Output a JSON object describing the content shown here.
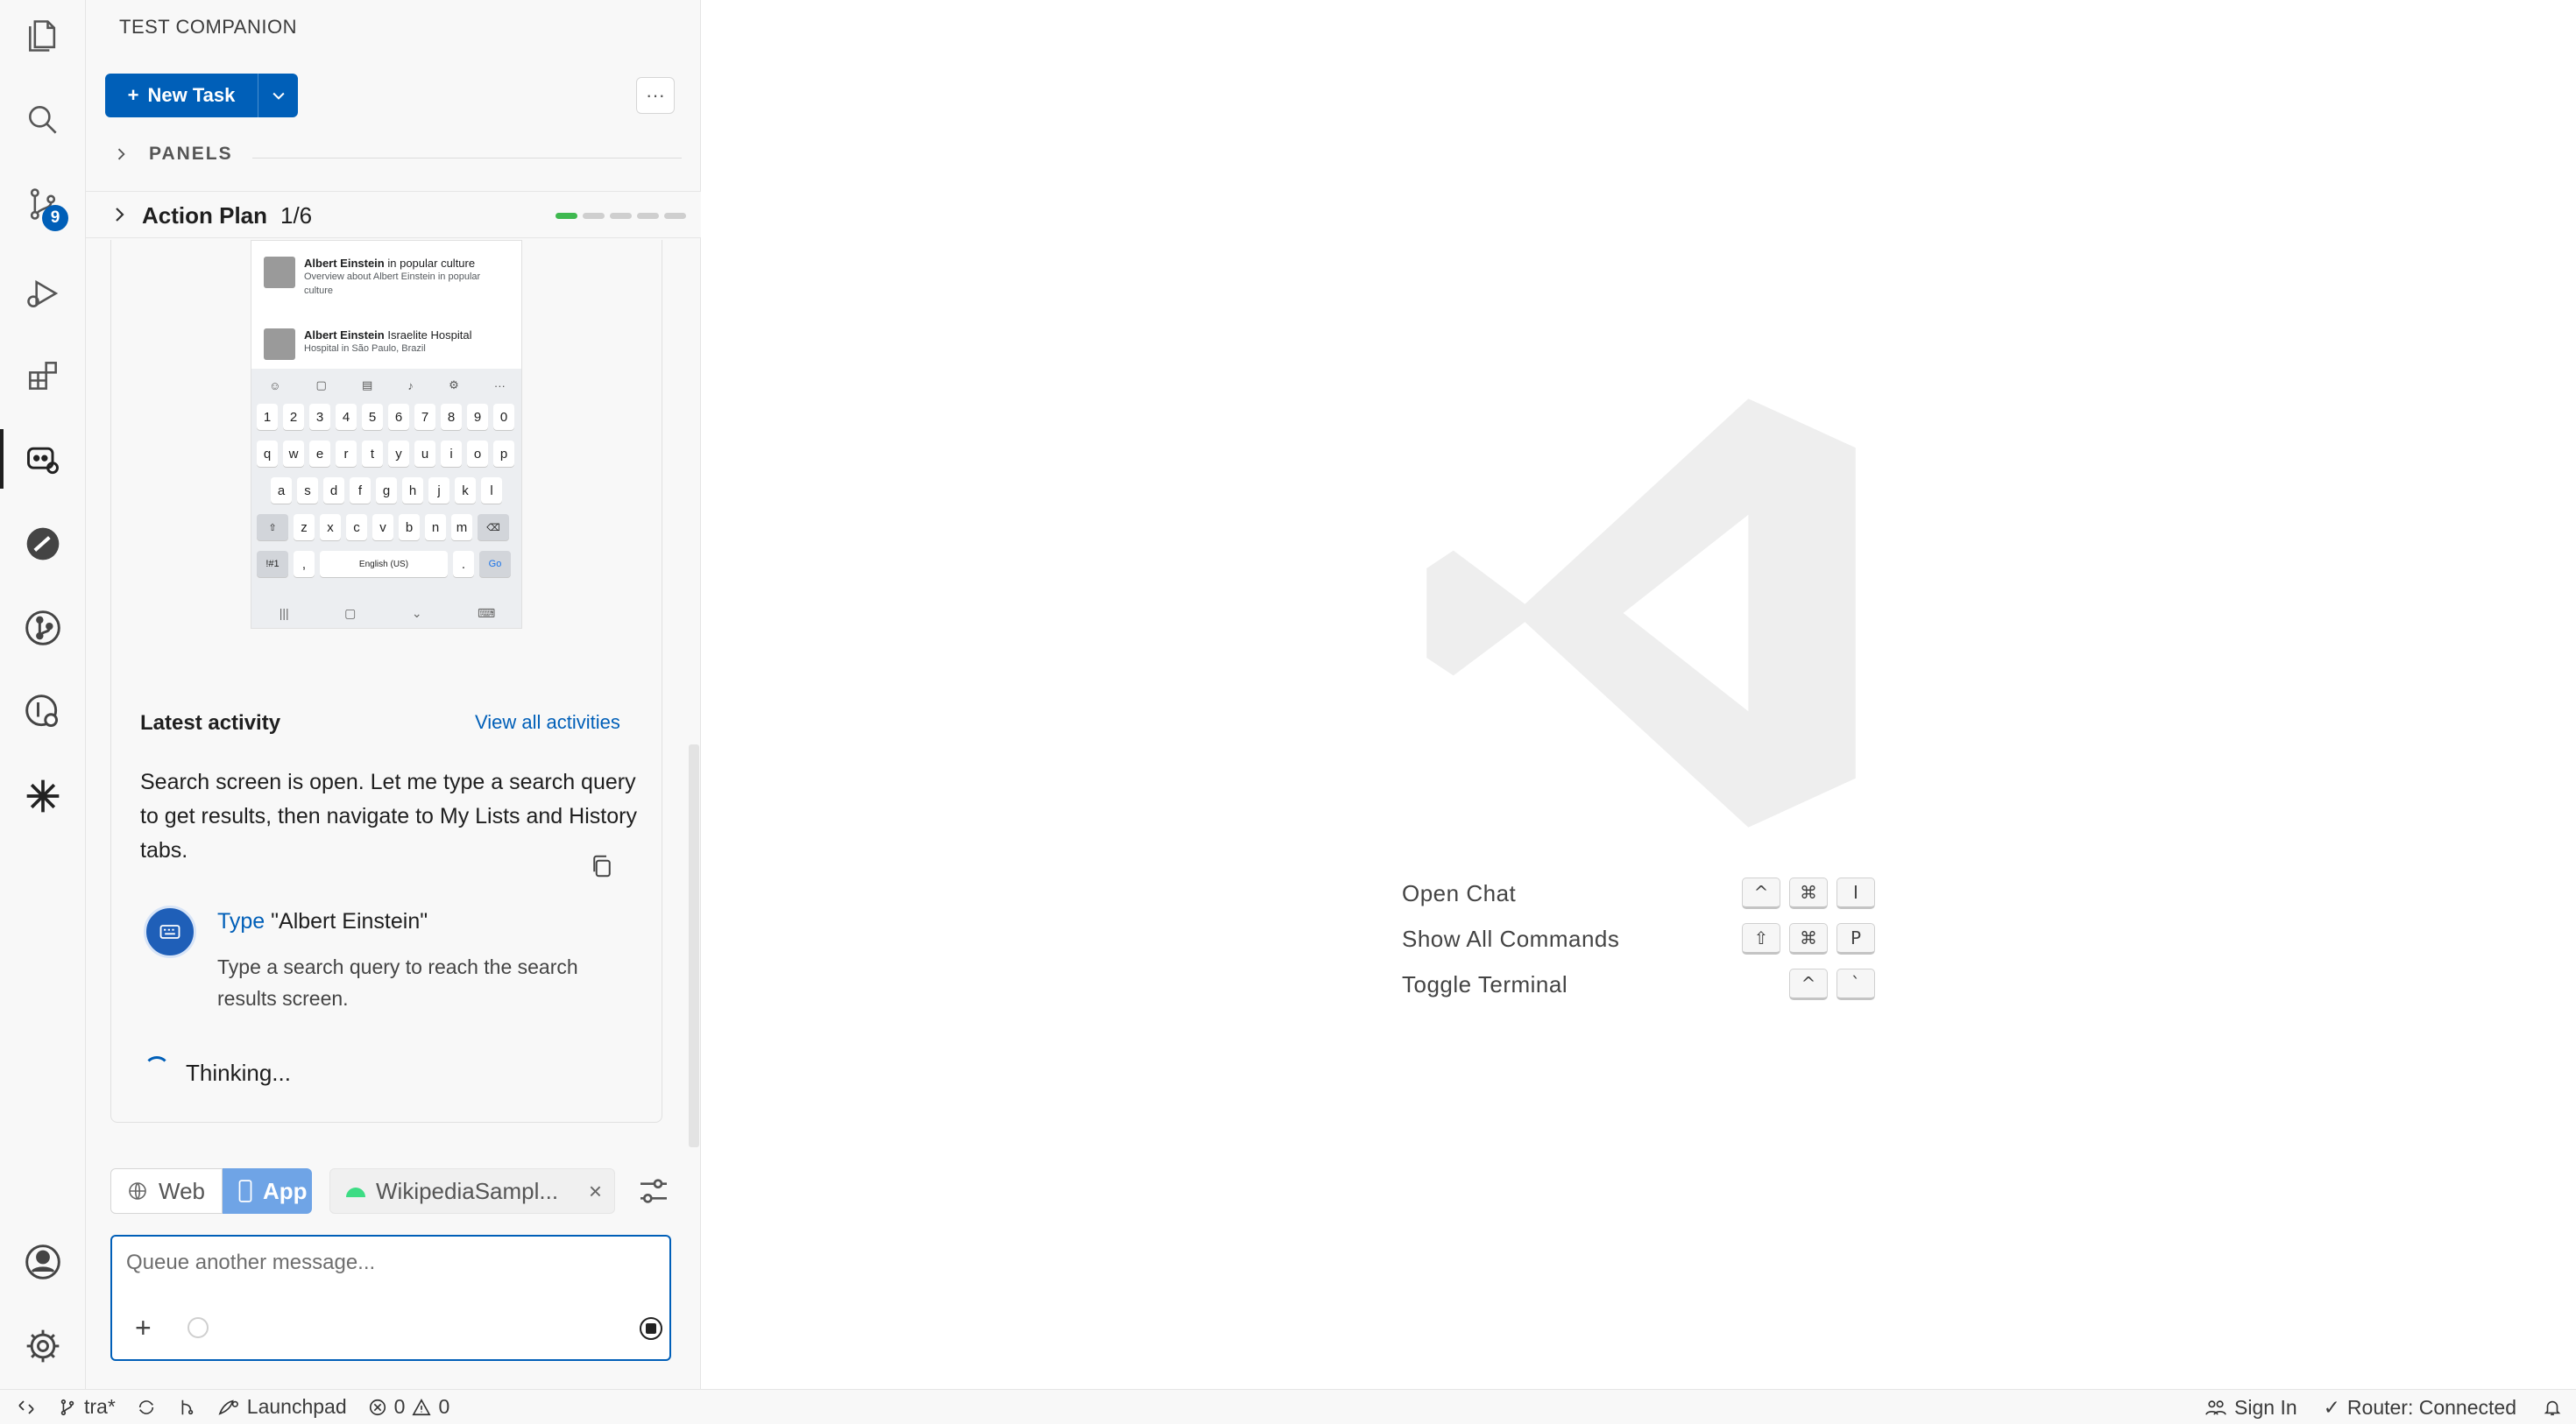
{
  "sidebar": {
    "title": "TEST COMPANION",
    "new_task_label": "New Task",
    "more_label": "···",
    "panels_label": "PANELS",
    "action_plan": {
      "title": "Action Plan",
      "count": "1/6",
      "progress_done": 1,
      "progress_total": 6
    },
    "source_control_badge": "9"
  },
  "phone": {
    "results": [
      {
        "title_bold": "Albert Einstein",
        "title_rest": " in popular culture",
        "desc": "Overview about Albert Einstein in popular culture"
      },
      {
        "title_bold": "Albert Einstein",
        "title_rest": " Israelite Hospital",
        "desc": "Hospital in São Paulo, Brazil"
      }
    ],
    "keyboard": {
      "row_numbers": [
        "1",
        "2",
        "3",
        "4",
        "5",
        "6",
        "7",
        "8",
        "9",
        "0"
      ],
      "row_top": [
        "q",
        "w",
        "e",
        "r",
        "t",
        "y",
        "u",
        "i",
        "o",
        "p"
      ],
      "row_mid": [
        "a",
        "s",
        "d",
        "f",
        "g",
        "h",
        "j",
        "k",
        "l"
      ],
      "row_bottom": [
        "z",
        "x",
        "c",
        "v",
        "b",
        "n",
        "m"
      ],
      "sym_key": "!#1",
      "comma_key": ",",
      "space_label": "English (US)",
      "period_key": ".",
      "go_key": "Go"
    }
  },
  "activity": {
    "latest_title": "Latest activity",
    "view_all": "View all activities",
    "message": "Search screen is open. Let me type a search query to get results, then navigate to My Lists and History tabs.",
    "step": {
      "action": "Type",
      "value": " \"Albert Einstein\"",
      "description": "Type a search query to reach the search results screen."
    },
    "thinking": "Thinking..."
  },
  "modes": {
    "web": "Web",
    "app": "App",
    "device": "WikipediaSampl...",
    "close": "×"
  },
  "input": {
    "placeholder": "Queue another message...",
    "plus": "+"
  },
  "editor": {
    "shortcuts": [
      {
        "label": "Open Chat",
        "keys": [
          "^",
          "⌘",
          "I"
        ]
      },
      {
        "label": "Show All Commands",
        "keys": [
          "⇧",
          "⌘",
          "P"
        ]
      },
      {
        "label": "Toggle Terminal",
        "keys": [
          "^",
          "`"
        ]
      }
    ]
  },
  "status_bar": {
    "branch": "tra*",
    "launchpad": "Launchpad",
    "errors": "0",
    "warnings": "0",
    "sign_in": "Sign In",
    "router": "Router: Connected"
  },
  "colors": {
    "accent": "#005fb8",
    "progress_done": "#3fb950",
    "app_tab": "#6fa4e6"
  }
}
